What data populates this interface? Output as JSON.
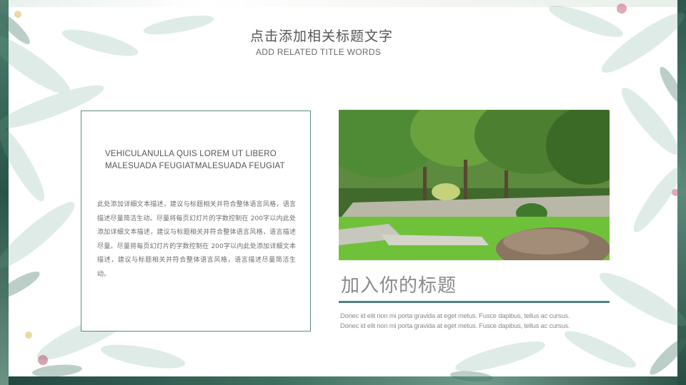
{
  "header": {
    "title_cn": "点击添加相关标题文字",
    "title_en": "ADD RELATED TITLE WORDS"
  },
  "left_box": {
    "heading_line1": "VEHICULANULLA QUIS LOREM UT LIBERO",
    "heading_line2": "MALESUADA FEUGIATMALESUADA FEUGIAT",
    "body": "此处添加详细文本描述，建议与标题相关并符合整体语言风格，语言描述尽量简洁生动。尽量将每页幻灯片的字数控制在 200字以内此处添加详细文本描述，建议与标题相关并符合整体语言风格，语言描述尽量。尽量将每页幻灯片的字数控制在 200字以内此处添加详细文本描述，建议与标题相关并符合整体语言风格，语言描述尽量简洁生动。"
  },
  "right_panel": {
    "photo_icon": "park-photo",
    "sub_title": "加入你的标题",
    "desc_line1": "Donec id elit non mi porta gravida at eget metus. Fusce dapibus, tellus ac cursus.",
    "desc_line2": "Donec id elit non mi porta gravida at eget metus. Fusce dapibus, tellus ac cursus."
  },
  "theme": {
    "accent": "#4f8580",
    "frame": "#2f5a50",
    "leaf": "#7fae9a"
  }
}
